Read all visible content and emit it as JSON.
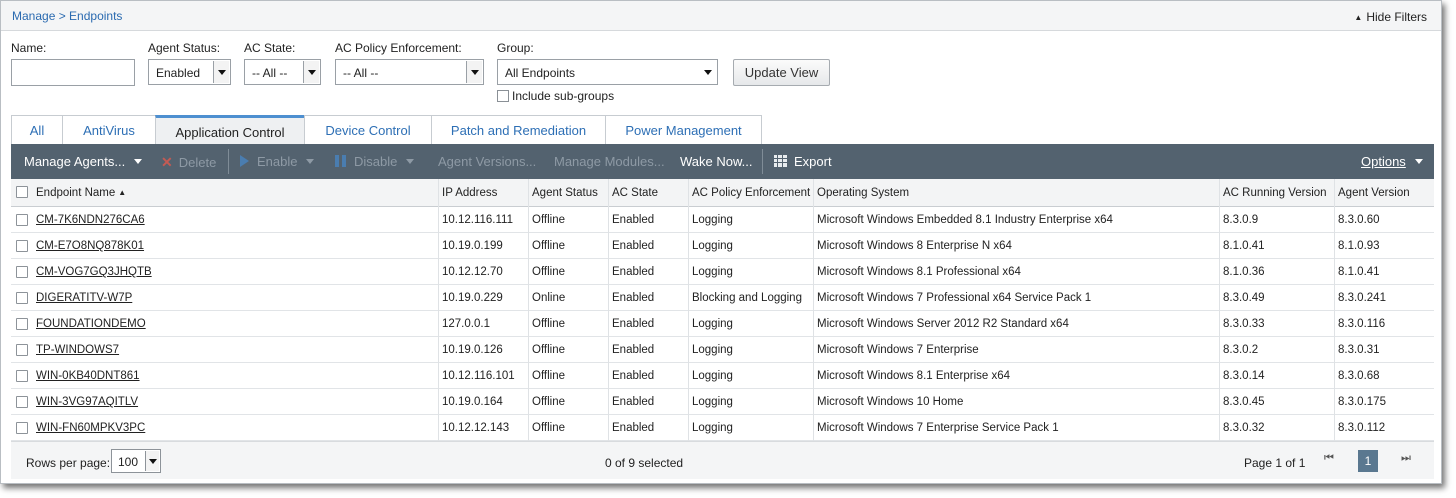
{
  "header": {
    "breadcrumb": "Manage > Endpoints",
    "hide_filters": "Hide Filters"
  },
  "filters": {
    "name_label": "Name:",
    "name_value": "",
    "agent_status_label": "Agent Status:",
    "agent_status_value": "Enabled",
    "ac_state_label": "AC State:",
    "ac_state_value": "-- All --",
    "ac_policy_label": "AC Policy Enforcement:",
    "ac_policy_value": "-- All --",
    "group_label": "Group:",
    "group_value": "All Endpoints",
    "update_button": "Update View",
    "include_subgroups": "Include sub-groups"
  },
  "tabs": [
    {
      "label": "All",
      "active": false
    },
    {
      "label": "AntiVirus",
      "active": false
    },
    {
      "label": "Application Control",
      "active": true
    },
    {
      "label": "Device Control",
      "active": false
    },
    {
      "label": "Patch and Remediation",
      "active": false
    },
    {
      "label": "Power Management",
      "active": false
    }
  ],
  "toolbar": {
    "manage_agents": "Manage Agents...",
    "delete": "Delete",
    "enable": "Enable",
    "disable": "Disable",
    "agent_versions": "Agent Versions...",
    "manage_modules": "Manage Modules...",
    "wake_now": "Wake Now...",
    "export": "Export",
    "options": "Options"
  },
  "table": {
    "columns": [
      "Endpoint Name",
      "IP Address",
      "Agent Status",
      "AC State",
      "AC Policy Enforcement",
      "Operating System",
      "AC Running Version",
      "Agent Version"
    ],
    "rows": [
      [
        "CM-7K6NDN276CA6",
        "10.12.116.111",
        "Offline",
        "Enabled",
        "Logging",
        "Microsoft Windows Embedded 8.1 Industry Enterprise x64",
        "8.3.0.9",
        "8.3.0.60"
      ],
      [
        "CM-E7O8NQ878K01",
        "10.19.0.199",
        "Offline",
        "Enabled",
        "Logging",
        "Microsoft Windows 8 Enterprise N x64",
        "8.1.0.41",
        "8.1.0.93"
      ],
      [
        "CM-VOG7GQ3JHQTB",
        "10.12.12.70",
        "Offline",
        "Enabled",
        "Logging",
        "Microsoft Windows 8.1 Professional x64",
        "8.1.0.36",
        "8.1.0.41"
      ],
      [
        "DIGERATITV-W7P",
        "10.19.0.229",
        "Online",
        "Enabled",
        "Blocking and Logging",
        "Microsoft Windows 7 Professional x64 Service Pack 1",
        "8.3.0.49",
        "8.3.0.241"
      ],
      [
        "FOUNDATIONDEMO",
        "127.0.0.1",
        "Offline",
        "Enabled",
        "Logging",
        "Microsoft Windows Server 2012 R2 Standard x64",
        "8.3.0.33",
        "8.3.0.116"
      ],
      [
        "TP-WINDOWS7",
        "10.19.0.126",
        "Offline",
        "Enabled",
        "Logging",
        "Microsoft Windows 7 Enterprise",
        "8.3.0.2",
        "8.3.0.31"
      ],
      [
        "WIN-0KB40DNT861",
        "10.12.116.101",
        "Offline",
        "Enabled",
        "Logging",
        "Microsoft Windows 8.1 Enterprise x64",
        "8.3.0.14",
        "8.3.0.68"
      ],
      [
        "WIN-3VG97AQITLV",
        "10.19.0.164",
        "Offline",
        "Enabled",
        "Logging",
        "Microsoft Windows 10 Home",
        "8.3.0.45",
        "8.3.0.175"
      ],
      [
        "WIN-FN60MPKV3PC",
        "10.12.12.143",
        "Offline",
        "Enabled",
        "Logging",
        "Microsoft Windows 7 Enterprise Service Pack 1",
        "8.3.0.32",
        "8.3.0.112"
      ]
    ]
  },
  "footer": {
    "rows_per_page_label": "Rows per page:",
    "rows_per_page_value": "100",
    "selected_text": "0 of 9 selected",
    "page_info": "Page 1 of 1",
    "current_page": "1"
  }
}
